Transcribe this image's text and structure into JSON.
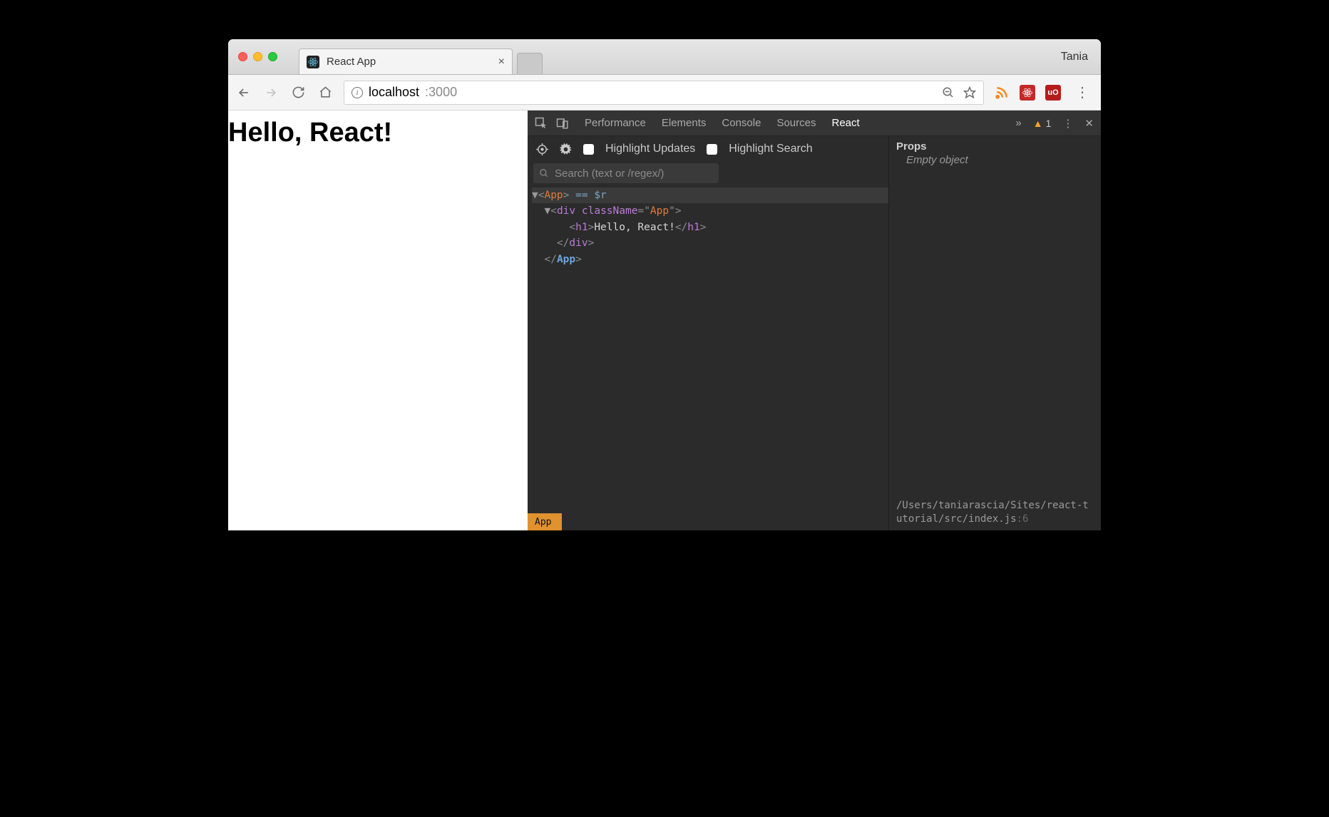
{
  "browser": {
    "tab_title": "React App",
    "profile_name": "Tania",
    "url_host": "localhost",
    "url_port": ":3000"
  },
  "page": {
    "heading": "Hello, React!"
  },
  "devtools": {
    "tabs": [
      "Performance",
      "Elements",
      "Console",
      "Sources",
      "React"
    ],
    "active_tab": "React",
    "overflow_glyph": "»",
    "warning_count": "1",
    "toolbar": {
      "highlight_updates": "Highlight Updates",
      "highlight_search": "Highlight Search",
      "search_placeholder": "Search (text or /regex/)"
    },
    "tree": {
      "row0_comp": "App",
      "row0_suffix": " == $r",
      "row1_el": "div",
      "row1_attr": "className",
      "row1_val": "App",
      "row2_el": "h1",
      "row2_text": "Hello, React!",
      "row3_close": "div",
      "row4_close": "App"
    },
    "breadcrumb": "App",
    "side": {
      "props_header": "Props",
      "props_empty": "Empty object",
      "source_path": "/Users/taniarascia/Sites/react-tutorial/src/index.js",
      "source_line": ":6"
    }
  }
}
